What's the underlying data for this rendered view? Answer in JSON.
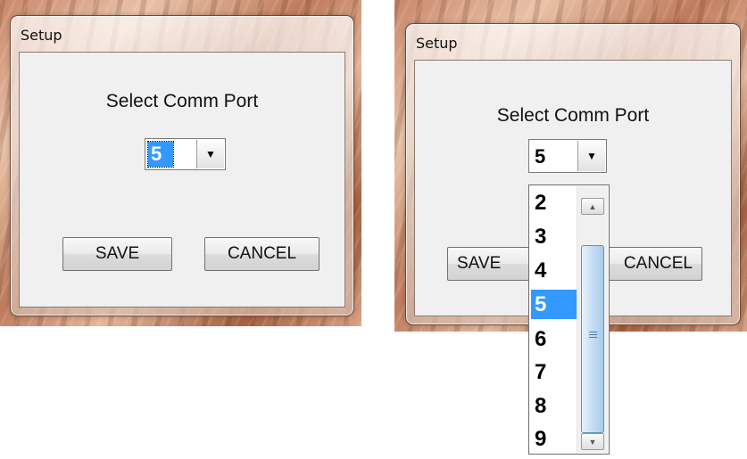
{
  "left_dialog": {
    "title": "Setup",
    "prompt": "Select Comm Port",
    "combo_value": "5",
    "save_label": "SAVE",
    "cancel_label": "CANCEL"
  },
  "right_dialog": {
    "title": "Setup",
    "prompt": "Select Comm Port",
    "combo_value": "5",
    "save_label": "SAVE",
    "cancel_label": "CANCEL",
    "dropdown_options": [
      "2",
      "3",
      "4",
      "5",
      "6",
      "7",
      "8",
      "9"
    ],
    "selected_option": "5"
  },
  "icons": {
    "dropdown_arrow": "chevron-down-icon",
    "scroll_up": "scroll-up-arrow-icon",
    "scroll_down": "scroll-down-arrow-icon",
    "thumb_grip": "grip-icon"
  },
  "colors": {
    "selection": "#3399ff",
    "scroll_thumb": "#a8cbe8",
    "dialog_face": "#f0f0f0"
  }
}
